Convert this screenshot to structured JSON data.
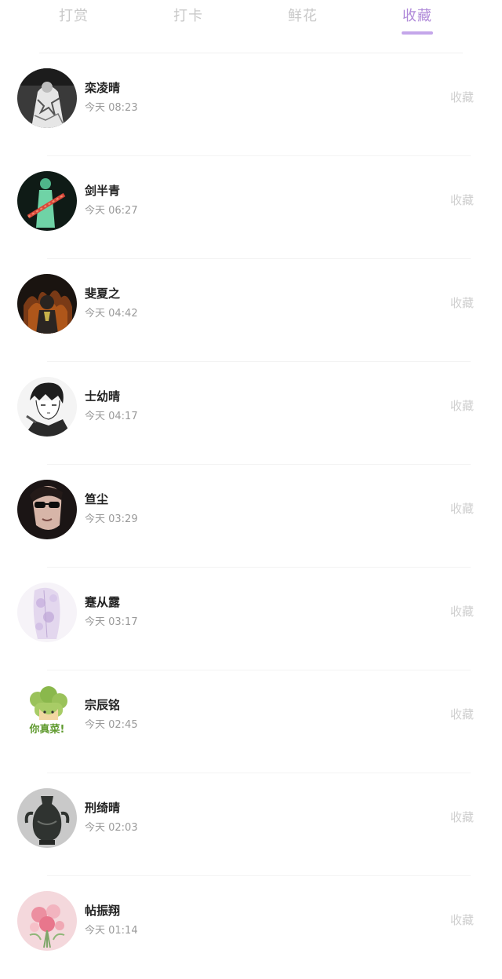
{
  "tabs": [
    {
      "label": "打赏",
      "active": false
    },
    {
      "label": "打卡",
      "active": false
    },
    {
      "label": "鲜花",
      "active": false
    },
    {
      "label": "收藏",
      "active": true
    }
  ],
  "colors": {
    "accent": "#b08ad9",
    "indicator": "#c4a6ea",
    "muted": "#c8c8c8"
  },
  "items": [
    {
      "name": "栾凌晴",
      "time": "今天 08:23",
      "action": "收藏",
      "avatar": "avatar-mono-portrait"
    },
    {
      "name": "剑半青",
      "time": "今天 06:27",
      "action": "收藏",
      "avatar": "avatar-green-figure"
    },
    {
      "name": "斐夏之",
      "time": "今天 04:42",
      "action": "收藏",
      "avatar": "avatar-dark-fire"
    },
    {
      "name": "士幼晴",
      "time": "今天 04:17",
      "action": "收藏",
      "avatar": "avatar-sketch-boy"
    },
    {
      "name": "笪尘",
      "time": "今天 03:29",
      "action": "收藏",
      "avatar": "avatar-sunglasses"
    },
    {
      "name": "蹇从露",
      "time": "今天 03:17",
      "action": "收藏",
      "avatar": "avatar-lavender-flowers"
    },
    {
      "name": "宗辰铭",
      "time": "今天 02:45",
      "action": "收藏",
      "avatar": "avatar-cartoon-sticker",
      "avatar_text": "你真菜!"
    },
    {
      "name": "刑绮晴",
      "time": "今天 02:03",
      "action": "收藏",
      "avatar": "avatar-bronze-vase"
    },
    {
      "name": "帖振翔",
      "time": "今天 01:14",
      "action": "收藏",
      "avatar": "avatar-pink-bouquet"
    }
  ]
}
